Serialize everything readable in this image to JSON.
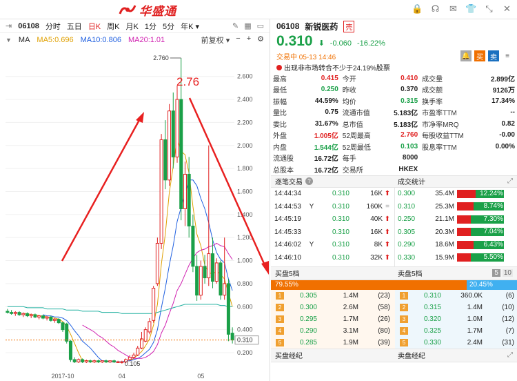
{
  "app": {
    "name": "华盛通"
  },
  "chart_toolbar": {
    "code": "06108",
    "periods": [
      "分时",
      "五日",
      "日K",
      "周K",
      "月K",
      "1分",
      "5分",
      "年K ▾"
    ],
    "active_period": "日K"
  },
  "ma_bar": {
    "label": "MA",
    "ma5": "MA5:0.696",
    "ma10": "MA10:0.806",
    "ma20": "MA20:1.01",
    "adjust": "前复权 ▾"
  },
  "chart_data": {
    "type": "candlestick",
    "ylim": [
      0.05,
      2.82
    ],
    "y_ticks": [
      2.6,
      2.4,
      2.2,
      2.0,
      1.8,
      1.6,
      1.4,
      1.2,
      1.0,
      0.8,
      0.6,
      0.4,
      0.2
    ],
    "y_tick_labels": [
      "2.600",
      "2.400",
      "2.200",
      "2.000",
      "1.800",
      "1.600",
      "1.400",
      "1.200",
      "1.000",
      "0.800",
      "0.600",
      "0.400",
      "0.200"
    ],
    "x_labels": [
      {
        "idx": 14,
        "text": "2017-10"
      },
      {
        "idx": 29,
        "text": "04"
      },
      {
        "idx": 49,
        "text": "05"
      }
    ],
    "annotations": {
      "max_label": "2.760",
      "max_idx": 44,
      "min_label": "0.105",
      "min_idx": 29,
      "current_price_label": "0.310",
      "current_price": 0.31,
      "red_label": "2.76"
    },
    "candles": [
      {
        "o": 0.56,
        "h": 0.58,
        "l": 0.54,
        "c": 0.55
      },
      {
        "o": 0.55,
        "h": 0.57,
        "l": 0.53,
        "c": 0.54
      },
      {
        "o": 0.54,
        "h": 0.56,
        "l": 0.52,
        "c": 0.55
      },
      {
        "o": 0.55,
        "h": 0.56,
        "l": 0.52,
        "c": 0.53
      },
      {
        "o": 0.53,
        "h": 0.55,
        "l": 0.51,
        "c": 0.54
      },
      {
        "o": 0.54,
        "h": 0.55,
        "l": 0.51,
        "c": 0.52
      },
      {
        "o": 0.52,
        "h": 0.54,
        "l": 0.5,
        "c": 0.53
      },
      {
        "o": 0.53,
        "h": 0.54,
        "l": 0.5,
        "c": 0.51
      },
      {
        "o": 0.51,
        "h": 0.53,
        "l": 0.49,
        "c": 0.52
      },
      {
        "o": 0.52,
        "h": 0.53,
        "l": 0.49,
        "c": 0.5
      },
      {
        "o": 0.5,
        "h": 0.52,
        "l": 0.48,
        "c": 0.51
      },
      {
        "o": 0.51,
        "h": 0.52,
        "l": 0.47,
        "c": 0.48
      },
      {
        "o": 0.48,
        "h": 0.5,
        "l": 0.46,
        "c": 0.49
      },
      {
        "o": 0.49,
        "h": 0.5,
        "l": 0.45,
        "c": 0.46
      },
      {
        "o": 0.46,
        "h": 0.47,
        "l": 0.38,
        "c": 0.4
      },
      {
        "o": 0.45,
        "h": 0.46,
        "l": 0.28,
        "c": 0.3
      },
      {
        "o": 0.3,
        "h": 0.31,
        "l": 0.12,
        "c": 0.14
      },
      {
        "o": 0.14,
        "h": 0.16,
        "l": 0.11,
        "c": 0.12
      },
      {
        "o": 0.12,
        "h": 0.15,
        "l": 0.11,
        "c": 0.14
      },
      {
        "o": 0.14,
        "h": 0.15,
        "l": 0.11,
        "c": 0.12
      },
      {
        "o": 0.12,
        "h": 0.14,
        "l": 0.11,
        "c": 0.13
      },
      {
        "o": 0.13,
        "h": 0.14,
        "l": 0.11,
        "c": 0.12
      },
      {
        "o": 0.12,
        "h": 0.14,
        "l": 0.11,
        "c": 0.13
      },
      {
        "o": 0.13,
        "h": 0.14,
        "l": 0.11,
        "c": 0.12
      },
      {
        "o": 0.12,
        "h": 0.13,
        "l": 0.11,
        "c": 0.13
      },
      {
        "o": 0.13,
        "h": 0.14,
        "l": 0.11,
        "c": 0.12
      },
      {
        "o": 0.12,
        "h": 0.13,
        "l": 0.11,
        "c": 0.13
      },
      {
        "o": 0.13,
        "h": 0.14,
        "l": 0.11,
        "c": 0.12
      },
      {
        "o": 0.12,
        "h": 0.13,
        "l": 0.11,
        "c": 0.12
      },
      {
        "o": 0.12,
        "h": 0.13,
        "l": 0.105,
        "c": 0.12
      },
      {
        "o": 0.12,
        "h": 0.15,
        "l": 0.11,
        "c": 0.14
      },
      {
        "o": 0.14,
        "h": 0.18,
        "l": 0.13,
        "c": 0.16
      },
      {
        "o": 0.16,
        "h": 0.2,
        "l": 0.15,
        "c": 0.18
      },
      {
        "o": 0.18,
        "h": 0.26,
        "l": 0.17,
        "c": 0.24
      },
      {
        "o": 0.24,
        "h": 0.38,
        "l": 0.23,
        "c": 0.32
      },
      {
        "o": 0.3,
        "h": 0.42,
        "l": 0.29,
        "c": 0.4
      },
      {
        "o": 0.38,
        "h": 0.5,
        "l": 0.36,
        "c": 0.47
      },
      {
        "o": 0.48,
        "h": 0.78,
        "l": 0.46,
        "c": 0.76
      },
      {
        "o": 0.8,
        "h": 1.2,
        "l": 0.78,
        "c": 1.15
      },
      {
        "o": 1.15,
        "h": 2.1,
        "l": 1.1,
        "c": 2.05
      },
      {
        "o": 2.05,
        "h": 2.22,
        "l": 1.62,
        "c": 1.7
      },
      {
        "o": 1.7,
        "h": 2.36,
        "l": 1.65,
        "c": 2.3
      },
      {
        "o": 2.3,
        "h": 2.46,
        "l": 1.8,
        "c": 1.9
      },
      {
        "o": 1.9,
        "h": 2.52,
        "l": 1.85,
        "c": 2.4
      },
      {
        "o": 2.4,
        "h": 2.76,
        "l": 1.35,
        "c": 1.45
      },
      {
        "o": 1.45,
        "h": 1.86,
        "l": 1.3,
        "c": 1.75
      },
      {
        "o": 1.75,
        "h": 1.9,
        "l": 1.2,
        "c": 1.3
      },
      {
        "o": 1.3,
        "h": 1.4,
        "l": 0.9,
        "c": 0.95
      },
      {
        "o": 0.95,
        "h": 1.05,
        "l": 0.65,
        "c": 0.7
      },
      {
        "o": 0.7,
        "h": 1.0,
        "l": 0.66,
        "c": 0.95
      },
      {
        "o": 0.95,
        "h": 1.05,
        "l": 0.8,
        "c": 0.85
      },
      {
        "o": 0.85,
        "h": 2.0,
        "l": 0.78,
        "c": 1.06
      },
      {
        "o": 1.06,
        "h": 1.2,
        "l": 0.76,
        "c": 0.82
      },
      {
        "o": 0.82,
        "h": 1.02,
        "l": 0.8,
        "c": 0.98
      },
      {
        "o": 0.98,
        "h": 1.0,
        "l": 0.66,
        "c": 0.7
      },
      {
        "o": 0.7,
        "h": 1.2,
        "l": 0.66,
        "c": 0.8
      },
      {
        "o": 0.8,
        "h": 0.84,
        "l": 0.3,
        "c": 0.36
      },
      {
        "o": 0.37,
        "h": 0.42,
        "l": 0.28,
        "c": 0.31
      }
    ],
    "series": [
      {
        "name": "MA5",
        "color": "#e0a000",
        "values": [
          null,
          null,
          null,
          null,
          0.54,
          0.54,
          0.53,
          0.53,
          0.52,
          0.52,
          0.51,
          0.5,
          0.5,
          0.49,
          0.47,
          0.43,
          0.36,
          0.28,
          0.2,
          0.13,
          0.13,
          0.13,
          0.12,
          0.12,
          0.13,
          0.12,
          0.12,
          0.12,
          0.12,
          0.12,
          0.13,
          0.13,
          0.15,
          0.18,
          0.21,
          0.26,
          0.32,
          0.44,
          0.62,
          0.97,
          1.23,
          1.59,
          1.82,
          2.07,
          1.95,
          1.92,
          1.76,
          1.47,
          1.23,
          1.13,
          0.96,
          0.9,
          0.88,
          0.91,
          0.88,
          0.84,
          0.72,
          0.6
        ]
      },
      {
        "name": "MA10",
        "color": "#2060e0",
        "values": [
          null,
          null,
          null,
          null,
          null,
          null,
          null,
          null,
          null,
          0.53,
          0.52,
          0.52,
          0.51,
          0.51,
          0.5,
          0.48,
          0.44,
          0.39,
          0.35,
          0.3,
          0.27,
          0.24,
          0.2,
          0.16,
          0.13,
          0.13,
          0.12,
          0.12,
          0.12,
          0.12,
          0.13,
          0.13,
          0.14,
          0.15,
          0.17,
          0.2,
          0.23,
          0.29,
          0.4,
          0.59,
          0.76,
          0.96,
          1.13,
          1.34,
          1.46,
          1.58,
          1.7,
          1.7,
          1.65,
          1.54,
          1.45,
          1.33,
          1.18,
          1.07,
          1.01,
          0.98,
          0.84,
          0.74
        ]
      },
      {
        "name": "MA20",
        "color": "#d020b0",
        "values": [
          null,
          null,
          null,
          null,
          null,
          null,
          null,
          null,
          null,
          null,
          null,
          null,
          null,
          null,
          null,
          null,
          null,
          null,
          null,
          0.44,
          0.42,
          0.4,
          0.38,
          0.35,
          0.33,
          0.3,
          0.27,
          0.25,
          0.22,
          0.2,
          0.18,
          0.16,
          0.15,
          0.15,
          0.15,
          0.16,
          0.18,
          0.21,
          0.27,
          0.37,
          0.44,
          0.54,
          0.63,
          0.74,
          0.8,
          0.88,
          0.96,
          1.02,
          1.07,
          1.09,
          1.1,
          1.12,
          1.13,
          1.15,
          1.13,
          1.12,
          1.06,
          1.01
        ]
      },
      {
        "name": "MA60",
        "color": "#20b0a0",
        "values": [
          0.6,
          0.6,
          0.6,
          0.6,
          0.6,
          0.59,
          0.59,
          0.59,
          0.59,
          0.59,
          0.58,
          0.58,
          0.58,
          0.58,
          0.58,
          0.57,
          0.57,
          0.57,
          0.57,
          0.56,
          0.56,
          0.56,
          0.56,
          0.56,
          0.55,
          0.55,
          0.55,
          0.55,
          0.55,
          0.54,
          0.54,
          0.54,
          0.54,
          0.54,
          0.54,
          0.54,
          0.54,
          0.54,
          0.55,
          0.56,
          0.57,
          0.58,
          0.59,
          0.6,
          0.61,
          0.62,
          0.62,
          0.62,
          0.62,
          0.62,
          0.62,
          0.62,
          0.62,
          0.62,
          0.61,
          0.61,
          0.6,
          0.6
        ]
      }
    ]
  },
  "quote": {
    "code": "06108",
    "name": "新锐医药",
    "tag": "壳",
    "price": "0.310",
    "change": "-0.060",
    "change_pct": "-16.22%",
    "status": "交易中 05-13 14:46",
    "notice": "出现非市场转合不少于24.19%股票",
    "btn_buy": "买",
    "btn_sell": "卖"
  },
  "stats": [
    [
      {
        "k": "最高",
        "v": "0.415",
        "c": "red"
      },
      {
        "k": "今开",
        "v": "0.410",
        "c": "red"
      },
      {
        "k": "成交量",
        "v": "2.899亿",
        "c": ""
      }
    ],
    [
      {
        "k": "最低",
        "v": "0.250",
        "c": "green"
      },
      {
        "k": "昨收",
        "v": "0.370",
        "c": ""
      },
      {
        "k": "成交额",
        "v": "9126万",
        "c": ""
      }
    ],
    [
      {
        "k": "振幅",
        "v": "44.59%",
        "c": ""
      },
      {
        "k": "均价",
        "v": "0.315",
        "c": "green"
      },
      {
        "k": "换手率",
        "v": "17.34%",
        "c": ""
      }
    ],
    [
      {
        "k": "量比",
        "v": "0.75",
        "c": ""
      },
      {
        "k": "流通市值",
        "v": "5.183亿",
        "c": ""
      },
      {
        "k": "市盈率TTM",
        "v": "--",
        "c": ""
      }
    ],
    [
      {
        "k": "委比",
        "v": "31.67%",
        "c": ""
      },
      {
        "k": "总市值",
        "v": "5.183亿",
        "c": ""
      },
      {
        "k": "市净率MRQ",
        "v": "0.82",
        "c": ""
      }
    ],
    [
      {
        "k": "外盘",
        "v": "1.005亿",
        "c": "red"
      },
      {
        "k": "52周最高",
        "v": "2.760",
        "c": "red"
      },
      {
        "k": "每股收益TTM",
        "v": "-0.00",
        "c": ""
      }
    ],
    [
      {
        "k": "内盘",
        "v": "1.544亿",
        "c": "green"
      },
      {
        "k": "52周最低",
        "v": "0.103",
        "c": "green"
      },
      {
        "k": "股息率TTM",
        "v": "0.00%",
        "c": ""
      }
    ],
    [
      {
        "k": "流通股",
        "v": "16.72亿",
        "c": ""
      },
      {
        "k": "每手",
        "v": "8000",
        "c": ""
      },
      {
        "k": "",
        "v": "",
        "c": ""
      }
    ],
    [
      {
        "k": "总股本",
        "v": "16.72亿",
        "c": ""
      },
      {
        "k": "交易所",
        "v": "HKEX",
        "c": ""
      },
      {
        "k": "",
        "v": "",
        "c": ""
      }
    ]
  ],
  "ticks": {
    "title": "逐笔交易",
    "rows": [
      {
        "t": "14:44:34",
        "f": "",
        "p": "0.310",
        "v": "16K",
        "d": "up"
      },
      {
        "t": "14:44:53",
        "f": "Y",
        "p": "0.310",
        "v": "160K",
        "d": "flat"
      },
      {
        "t": "14:45:19",
        "f": "",
        "p": "0.310",
        "v": "40K",
        "d": "up"
      },
      {
        "t": "14:45:33",
        "f": "",
        "p": "0.310",
        "v": "16K",
        "d": "up"
      },
      {
        "t": "14:46:02",
        "f": "Y",
        "p": "0.310",
        "v": "8K",
        "d": "up"
      },
      {
        "t": "14:46:10",
        "f": "",
        "p": "0.310",
        "v": "32K",
        "d": "up"
      }
    ]
  },
  "volstats": {
    "title": "成交统计",
    "rows": [
      {
        "p": "0.300",
        "v": "35.4M",
        "pct": "12.24%",
        "red": 0.4
      },
      {
        "p": "0.310",
        "v": "25.3M",
        "pct": "8.74%",
        "red": 0.35
      },
      {
        "p": "0.250",
        "v": "21.1M",
        "pct": "7.30%",
        "red": 0.3
      },
      {
        "p": "0.305",
        "v": "20.3M",
        "pct": "7.04%",
        "red": 0.3
      },
      {
        "p": "0.290",
        "v": "18.6M",
        "pct": "6.43%",
        "red": 0.35
      },
      {
        "p": "0.330",
        "v": "15.9M",
        "pct": "5.50%",
        "red": 0.3
      }
    ]
  },
  "orderbook": {
    "bid_title": "买盘5档",
    "ask_title": "卖盘5档",
    "levels": "5",
    "levels_alt": "10",
    "bid_pct": "79.55%",
    "ask_pct": "20.45%",
    "bids": [
      {
        "n": "1",
        "p": "0.305",
        "v": "1.4M",
        "c": "(23)"
      },
      {
        "n": "2",
        "p": "0.300",
        "v": "2.6M",
        "c": "(58)"
      },
      {
        "n": "3",
        "p": "0.295",
        "v": "1.7M",
        "c": "(26)"
      },
      {
        "n": "4",
        "p": "0.290",
        "v": "3.1M",
        "c": "(80)"
      },
      {
        "n": "5",
        "p": "0.285",
        "v": "1.9M",
        "c": "(39)"
      }
    ],
    "asks": [
      {
        "n": "1",
        "p": "0.310",
        "v": "360.0K",
        "c": "(6)"
      },
      {
        "n": "2",
        "p": "0.315",
        "v": "1.4M",
        "c": "(10)"
      },
      {
        "n": "3",
        "p": "0.320",
        "v": "1.0M",
        "c": "(12)"
      },
      {
        "n": "4",
        "p": "0.325",
        "v": "1.7M",
        "c": "(7)"
      },
      {
        "n": "5",
        "p": "0.330",
        "v": "2.4M",
        "c": "(31)"
      }
    ]
  },
  "brokers": {
    "bid_title": "买盘经纪",
    "ask_title": "卖盘经纪"
  },
  "colors": {
    "up": "#e02020",
    "down": "#1aa048",
    "accent": "#f07000"
  }
}
